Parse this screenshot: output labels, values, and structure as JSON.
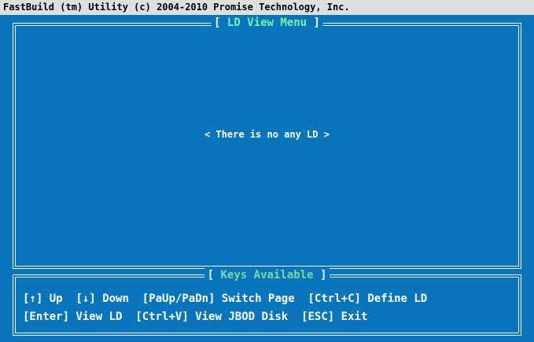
{
  "app_title": "FastBuild (tm) Utility (c) 2004-2010 Promise Technology, Inc.",
  "main_panel": {
    "title": "LD View Menu",
    "message": "< There is no any LD >"
  },
  "keys_panel": {
    "title": "Keys Available",
    "line1": [
      {
        "key": "[↑]",
        "action": "Up"
      },
      {
        "key": "[↓]",
        "action": "Down"
      },
      {
        "key": "[PaUp/PaDn]",
        "action": "Switch Page"
      },
      {
        "key": "[Ctrl+C]",
        "action": "Define LD"
      }
    ],
    "line2": [
      {
        "key": "[Enter]",
        "action": "View LD"
      },
      {
        "key": "[Ctrl+V]",
        "action": "View JBOD Disk"
      },
      {
        "key": "[ESC]",
        "action": "Exit"
      }
    ]
  },
  "colors": {
    "background": "#0875bd",
    "title_bar": "#dfdfdf",
    "panel_title": "#7ff0a6",
    "text": "#ffffff"
  }
}
